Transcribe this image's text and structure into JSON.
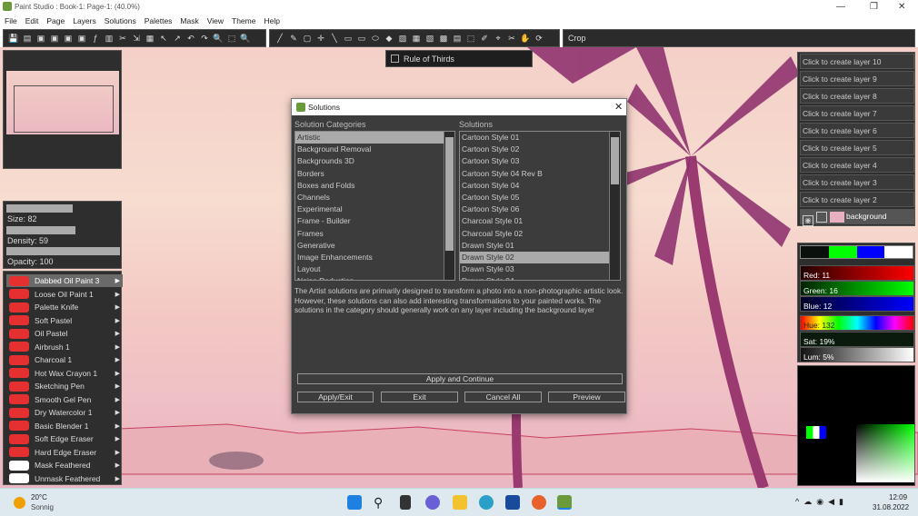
{
  "window": {
    "title": "Paint Studio : Book-1: Page-1:  (40.0%)"
  },
  "menu": [
    "File",
    "Edit",
    "Page",
    "Layers",
    "Solutions",
    "Palettes",
    "Mask",
    "View",
    "Theme",
    "Help"
  ],
  "toolbar": {
    "tool_name": "Crop"
  },
  "rule_of_thirds": {
    "label": "Rule of Thirds",
    "checked": false
  },
  "brush_settings": {
    "size": {
      "label": "Size: 82",
      "value": 82
    },
    "density": {
      "label": "Density: 59",
      "value": 59
    },
    "opacity": {
      "label": "Opacity: 100",
      "value": 100
    }
  },
  "brushes": [
    "Dabbed Oil Paint 3",
    "Loose Oil Paint 1",
    "Palette Knife",
    "Soft Pastel",
    "Oil Pastel",
    "Airbrush 1",
    "Charcoal 1",
    "Hot Wax Crayon 1",
    "Sketching Pen",
    "Smooth Gel Pen",
    "Dry Watercolor 1",
    "Basic Blender 1",
    "Soft Edge Eraser",
    "Hard Edge Eraser",
    "Mask Feathered",
    "Unmask Feathered"
  ],
  "selected_brush": "Dabbed Oil Paint 3",
  "layers": {
    "empty": [
      "Click to create layer 10",
      "Click to create layer 9",
      "Click to create layer 8",
      "Click to create layer 7",
      "Click to create layer 6",
      "Click to create layer 5",
      "Click to create layer 4",
      "Click to create layer 3",
      "Click to create layer 2"
    ],
    "background": "background"
  },
  "colors": {
    "swatches": [
      "#0b100c",
      "#00ff00",
      "#0000ff",
      "#ffffff"
    ],
    "red": "Red: 11",
    "green": "Green: 16",
    "blue": "Blue: 12",
    "hue": "Hue: 132",
    "sat": "Sat: 19%",
    "lum": "Lum: 5%"
  },
  "dialog": {
    "title": "Solutions",
    "categories_label": "Solution Categories",
    "solutions_label": "Solutions",
    "categories": [
      "Artistic",
      "Background Removal",
      "Backgrounds 3D",
      "Borders",
      "Boxes and Folds",
      "Channels",
      "Experimental",
      "Frame - Builder",
      "Frames",
      "Generative",
      "Image Enhancements",
      "Layout",
      "Noise Reduction"
    ],
    "selected_category": "Artistic",
    "solutions": [
      "Cartoon Style 01",
      "Cartoon Style 02",
      "Cartoon Style 03",
      "Cartoon Style 04 Rev B",
      "Cartoon Style 04",
      "Cartoon Style 05",
      "Cartoon Style 06",
      "Charcoal Style 01",
      "Charcoal Style 02",
      "Drawn Style 01",
      "Drawn Style 02",
      "Drawn Style 03",
      "Drawn Style 04"
    ],
    "selected_solution": "Drawn Style 02",
    "description": "The Artist solutions are primarily designed to transform a photo into a non-photographic artistic look. However, these solutions can also add interesting transformations to your painted works. The solutions in the category should generally work on any layer including the background layer",
    "apply_continue": "Apply and Continue",
    "apply_exit": "Apply/Exit",
    "exit": "Exit",
    "cancel_all": "Cancel All",
    "preview": "Preview"
  },
  "taskbar": {
    "temp": "20°C",
    "weather": "Sonnig",
    "time": "12:09",
    "date": "31.08.2022"
  }
}
